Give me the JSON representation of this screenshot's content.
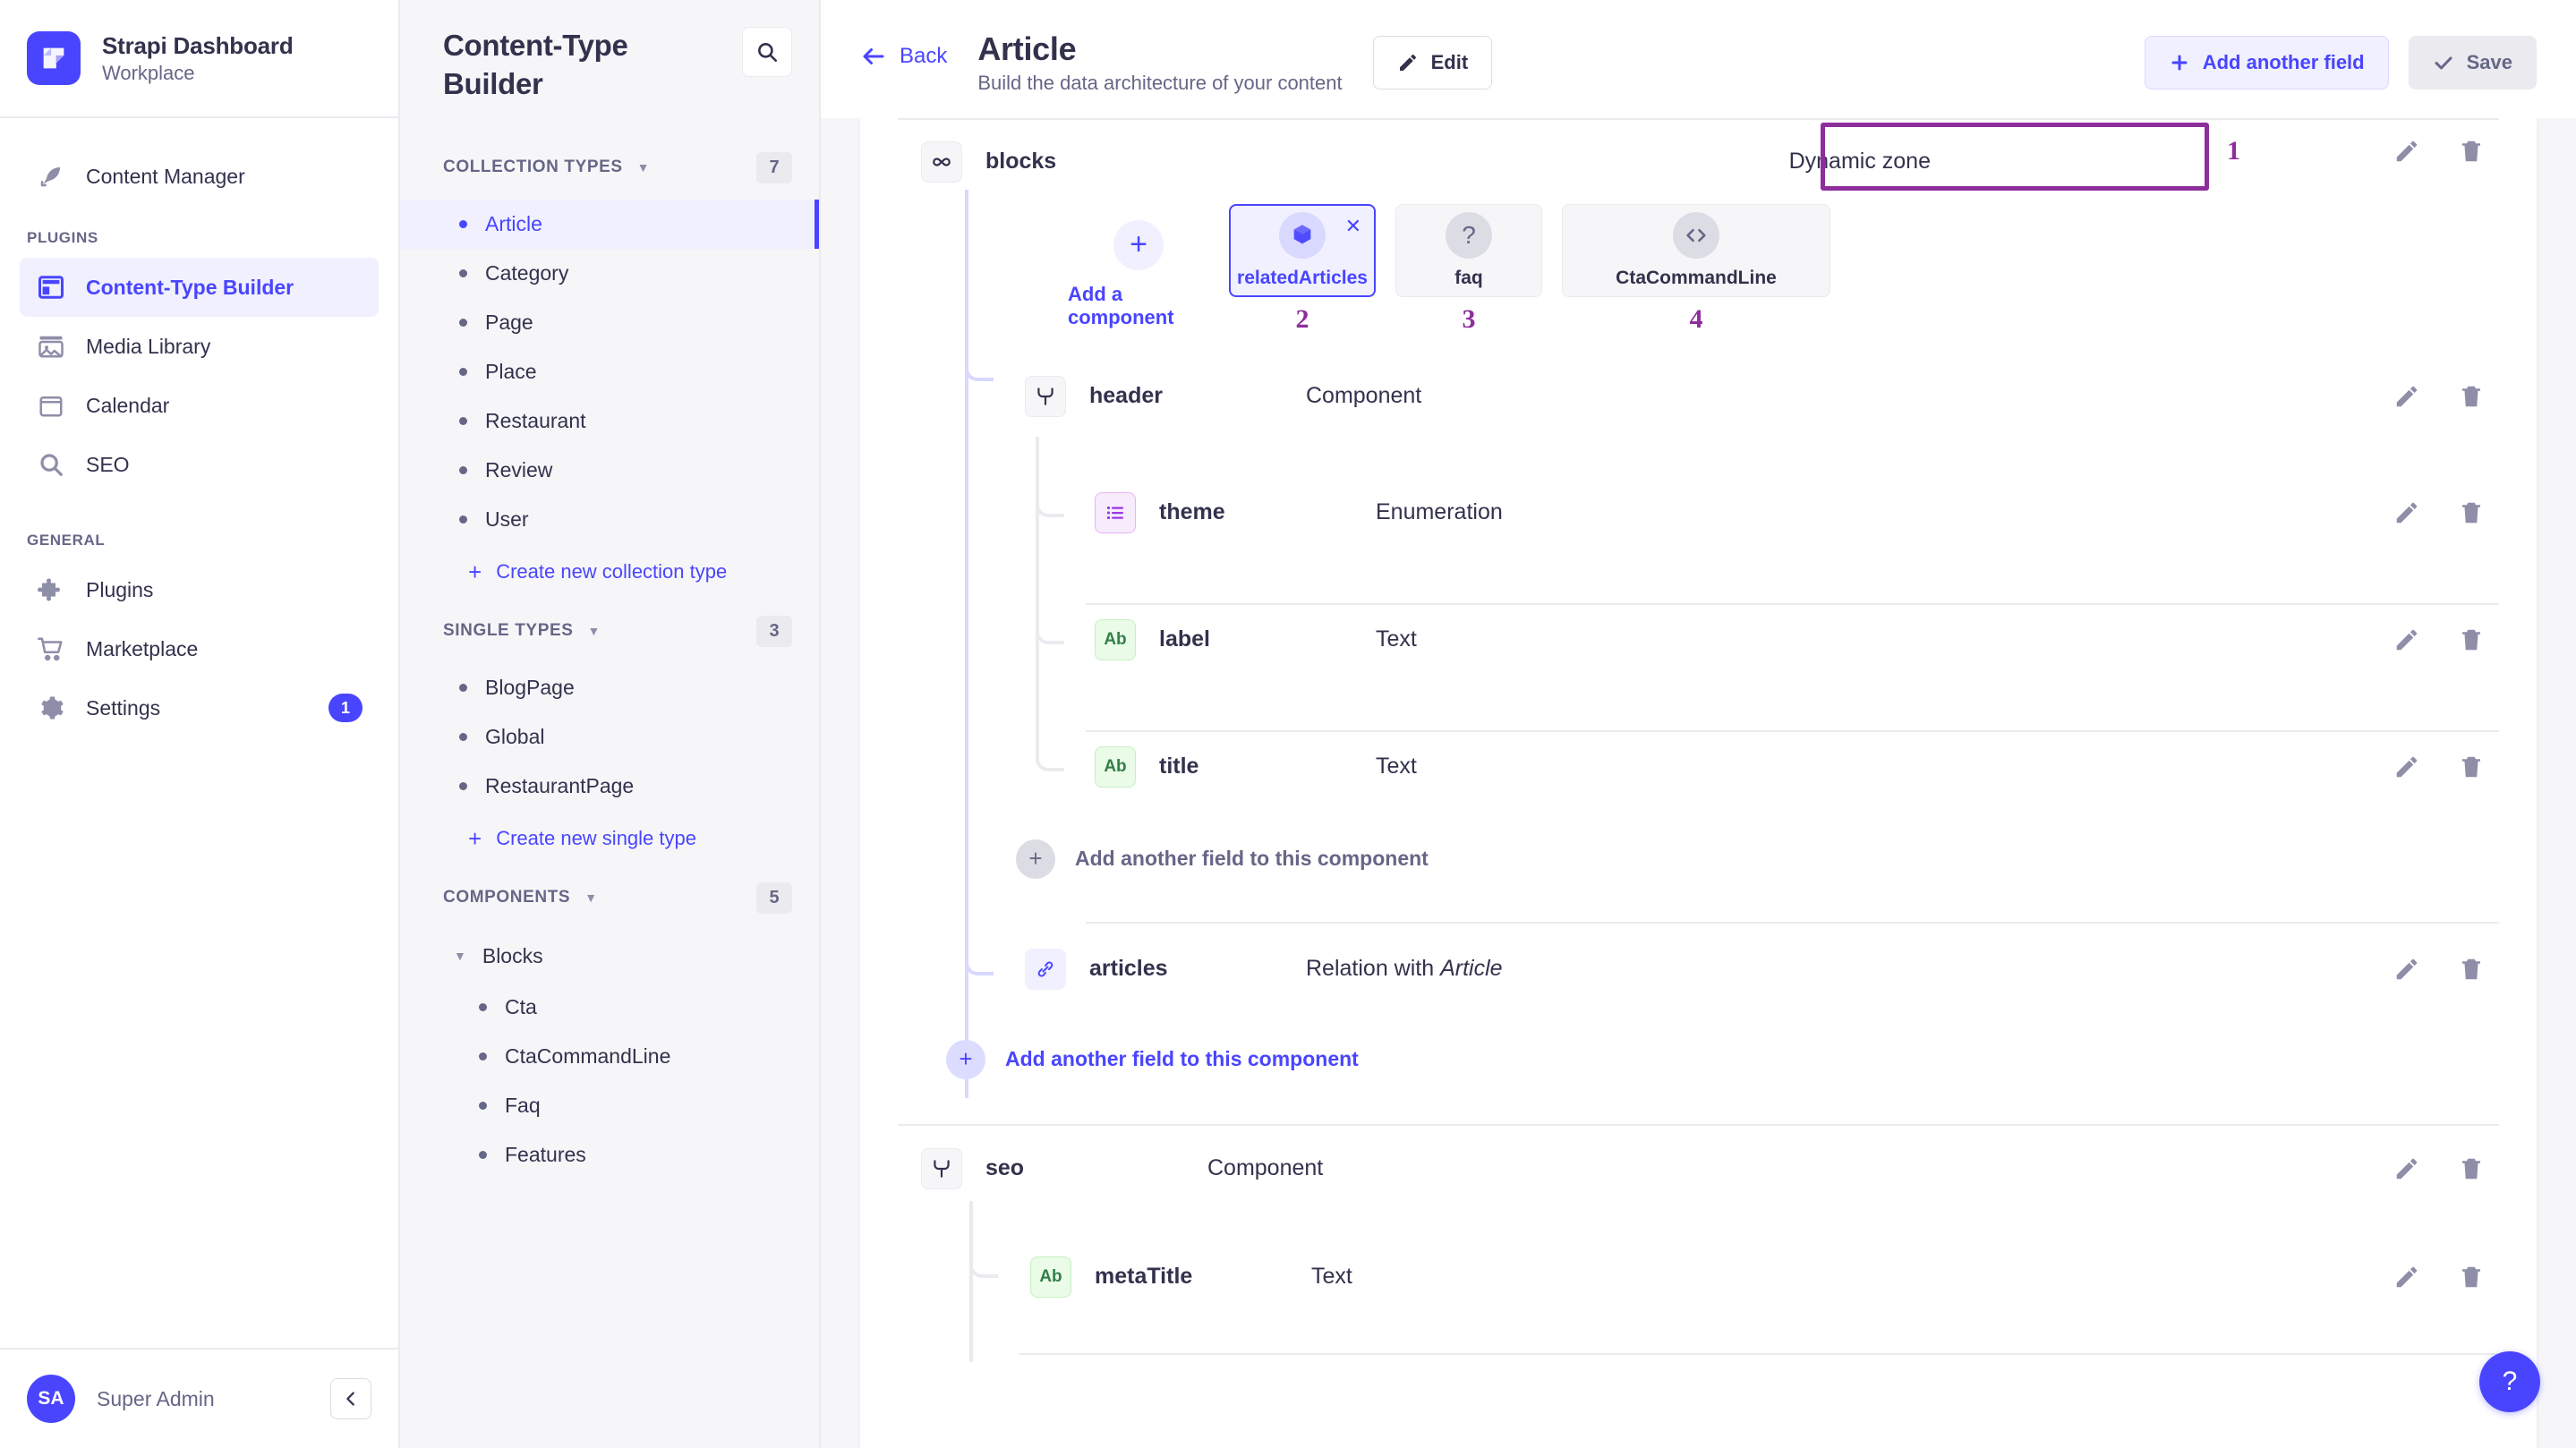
{
  "sidebar": {
    "brand": {
      "title": "Strapi Dashboard",
      "subtitle": "Workplace",
      "logo_icon": "strapi-logo-icon"
    },
    "primary_items": [
      {
        "label": "Content Manager",
        "icon": "feather-pen-icon",
        "active": false
      }
    ],
    "sections": [
      {
        "label": "PLUGINS",
        "items": [
          {
            "label": "Content-Type Builder",
            "icon": "layout-builder-icon",
            "active": true
          },
          {
            "label": "Media Library",
            "icon": "image-icon",
            "active": false
          },
          {
            "label": "Calendar",
            "icon": "calendar-icon",
            "active": false
          },
          {
            "label": "SEO",
            "icon": "search-icon",
            "active": false
          }
        ]
      },
      {
        "label": "GENERAL",
        "items": [
          {
            "label": "Plugins",
            "icon": "puzzle-icon",
            "active": false
          },
          {
            "label": "Marketplace",
            "icon": "shopping-cart-icon",
            "active": false
          },
          {
            "label": "Settings",
            "icon": "gear-icon",
            "active": false,
            "badge": "1"
          }
        ]
      }
    ],
    "user": {
      "initials": "SA",
      "name": "Super Admin",
      "collapse_icon": "chevron-left-icon"
    }
  },
  "ctb": {
    "title": "Content-Type Builder",
    "search_icon": "search-icon",
    "groups": [
      {
        "label": "COLLECTION TYPES",
        "count": "7",
        "items": [
          {
            "label": "Article",
            "active": true
          },
          {
            "label": "Category",
            "active": false
          },
          {
            "label": "Page",
            "active": false
          },
          {
            "label": "Place",
            "active": false
          },
          {
            "label": "Restaurant",
            "active": false
          },
          {
            "label": "Review",
            "active": false
          },
          {
            "label": "User",
            "active": false
          }
        ],
        "create_label": "Create new collection type"
      },
      {
        "label": "SINGLE TYPES",
        "count": "3",
        "items": [
          {
            "label": "BlogPage",
            "active": false
          },
          {
            "label": "Global",
            "active": false
          },
          {
            "label": "RestaurantPage",
            "active": false
          }
        ],
        "create_label": "Create new single type"
      },
      {
        "label": "COMPONENTS",
        "count": "5",
        "group_name": "Blocks",
        "items": [
          {
            "label": "Cta",
            "active": false
          },
          {
            "label": "CtaCommandLine",
            "active": false
          },
          {
            "label": "Faq",
            "active": false
          },
          {
            "label": "Features",
            "active": false
          }
        ]
      }
    ]
  },
  "header": {
    "back_label": "Back",
    "back_icon": "arrow-left-icon",
    "title": "Article",
    "subtitle": "Build the data architecture of your content",
    "edit_label": "Edit",
    "edit_icon": "pencil-icon",
    "add_field_label": "Add another field",
    "add_field_icon": "plus-icon",
    "save_label": "Save",
    "save_icon": "check-icon"
  },
  "fields": {
    "dynamic_zone": {
      "name": "blocks",
      "type": "Dynamic zone",
      "icon": "infinity-icon",
      "annotation": "1",
      "add_component_label": "Add a component",
      "add_component_icon": "plus-icon",
      "components": [
        {
          "name": "relatedArticles",
          "icon": "cube-icon",
          "selected": true,
          "annotation": "2",
          "close_icon": "close-icon"
        },
        {
          "name": "faq",
          "icon": "question-mark-icon",
          "selected": false,
          "annotation": "3"
        },
        {
          "name": "CtaCommandLine",
          "icon": "code-brackets-icon",
          "selected": false,
          "annotation": "4"
        }
      ]
    },
    "rows": [
      {
        "name": "header",
        "type": "Component",
        "chip": "component-icon",
        "chip_style": "gray",
        "depth": 1
      },
      {
        "name": "theme",
        "type": "Enumeration",
        "chip": "list-icon",
        "chip_style": "purple",
        "depth": 2
      },
      {
        "name": "label",
        "type": "Text",
        "chip": "Ab",
        "chip_style": "green",
        "depth": 2
      },
      {
        "name": "title",
        "type": "Text",
        "chip": "Ab",
        "chip_style": "green",
        "depth": 2
      },
      {
        "name": "articles",
        "type": "Relation with ",
        "type_em": "Article",
        "chip": "link-icon",
        "chip_style": "blue",
        "depth": 1
      },
      {
        "name": "seo",
        "type": "Component",
        "chip": "component-icon",
        "chip_style": "gray",
        "depth": 1
      },
      {
        "name": "metaTitle",
        "type": "Text",
        "chip": "Ab",
        "chip_style": "green",
        "depth": 2
      }
    ],
    "add_inner_label": "Add another field to this component",
    "add_outer_label": "Add another field to this component",
    "edit_icon": "pencil-icon",
    "delete_icon": "trash-icon"
  },
  "help": {
    "label": "?",
    "icon": "question-mark-icon"
  },
  "colors": {
    "accent": "#4945ff",
    "annotation": "#8e2e9c",
    "text": "#32324d",
    "muted": "#666687",
    "panel_bg": "#f6f6f9",
    "border": "#eaeaef"
  }
}
